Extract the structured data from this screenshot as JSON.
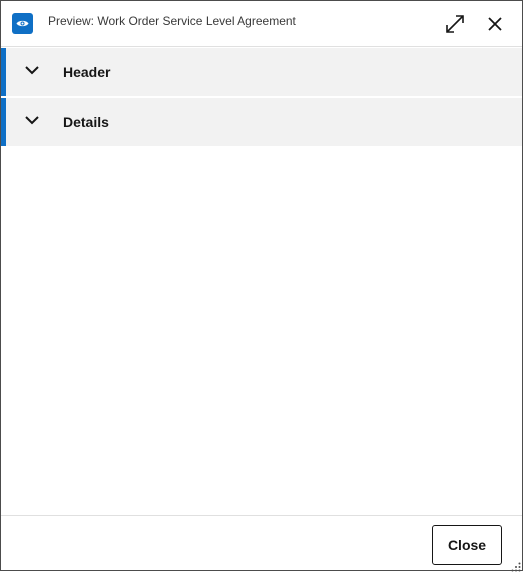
{
  "dialog": {
    "title": "Preview: Work Order Service Level Agreement",
    "title_icon": "eye-icon",
    "controls": {
      "expand_icon": "expand-icon",
      "close_icon": "close-icon"
    }
  },
  "sections": [
    {
      "label": "Header",
      "expanded": false
    },
    {
      "label": "Details",
      "expanded": false
    }
  ],
  "footer": {
    "close_label": "Close"
  },
  "colors": {
    "accent": "#0f6fc5",
    "section_bg": "#f2f2f2",
    "border": "#4c4c4c"
  }
}
